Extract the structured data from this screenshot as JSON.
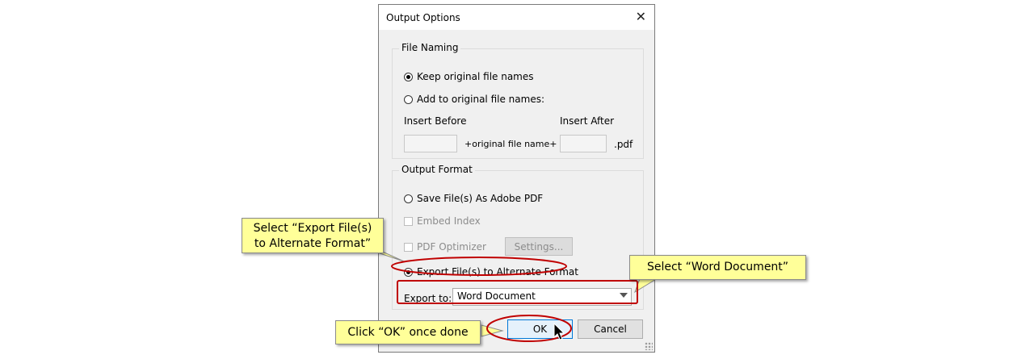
{
  "dialog": {
    "title": "Output Options",
    "file_naming": {
      "legend": "File Naming",
      "keep_original": "Keep original file names",
      "add_to_original": "Add to original file names:",
      "insert_before_label": "Insert Before",
      "insert_after_label": "Insert After",
      "original_name_label": "+original file name+",
      "extension": ".pdf",
      "insert_before_value": "",
      "insert_after_value": "",
      "selected": "keep_original"
    },
    "output_format": {
      "legend": "Output Format",
      "save_as_pdf": "Save File(s) As Adobe PDF",
      "embed_index": "Embed Index",
      "pdf_optimizer": "PDF Optimizer",
      "settings_button": "Settings...",
      "export_alternate": "Export File(s) to Alternate Format",
      "export_to_label": "Export to:",
      "export_to_value": "Word Document",
      "selected": "export_alternate"
    },
    "buttons": {
      "ok": "OK",
      "cancel": "Cancel"
    }
  },
  "annotations": {
    "callout_export_line1": "Select “Export File(s)",
    "callout_export_line2": "to Alternate Format”",
    "callout_word": "Select “Word Document”",
    "callout_ok": "Click “OK” once done",
    "highlight_color": "#c00000",
    "callout_color": "#ffff99"
  }
}
